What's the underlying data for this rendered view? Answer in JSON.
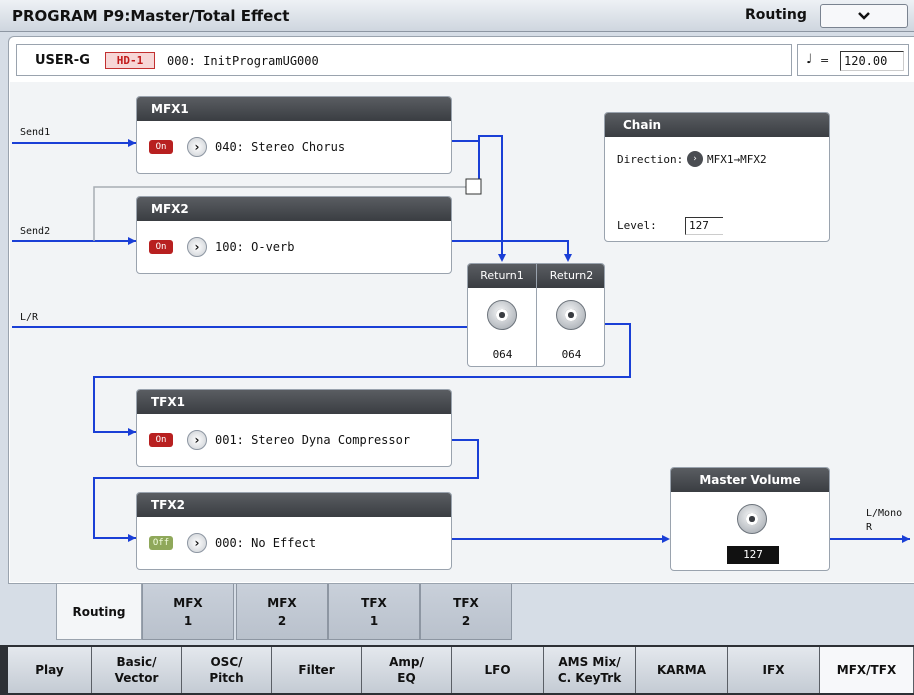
{
  "header": {
    "title": "PROGRAM P9:Master/Total Effect",
    "page_tag": "Routing"
  },
  "program": {
    "bank": "USER-G",
    "hd_badge": "HD-1",
    "name": "000: InitProgramUG000"
  },
  "tempo": {
    "note_symbol": "♩",
    "equals": "=",
    "value": "120.00"
  },
  "routes": {
    "send1": "Send1",
    "send2": "Send2",
    "lr": "L/R",
    "out_left": "L/Mono",
    "out_right": "R"
  },
  "mfx1": {
    "title": "MFX1",
    "state": "On",
    "effect": "040: Stereo Chorus"
  },
  "mfx2": {
    "title": "MFX2",
    "state": "On",
    "effect": "100: O-verb"
  },
  "tfx1": {
    "title": "TFX1",
    "state": "On",
    "effect": "001: Stereo Dyna Compressor"
  },
  "tfx2": {
    "title": "TFX2",
    "state": "Off",
    "effect": "000: No Effect"
  },
  "chain": {
    "title": "Chain",
    "direction_label": "Direction:",
    "direction_value": "MFX1→MFX2",
    "level_label": "Level:",
    "level_value": "127"
  },
  "returns": {
    "return1_label": "Return1",
    "return1_value": "064",
    "return2_label": "Return2",
    "return2_value": "064"
  },
  "master": {
    "title": "Master Volume",
    "value": "127"
  },
  "subtabs": [
    {
      "label": "Routing"
    },
    {
      "label": "MFX\n1"
    },
    {
      "label": "MFX\n2"
    },
    {
      "label": "TFX\n1"
    },
    {
      "label": "TFX\n2"
    }
  ],
  "bottom_tabs": [
    {
      "label": "Play"
    },
    {
      "label": "Basic/\nVector"
    },
    {
      "label": "OSC/\nPitch"
    },
    {
      "label": "Filter"
    },
    {
      "label": "Amp/\nEQ"
    },
    {
      "label": "LFO"
    },
    {
      "label": "AMS Mix/\nC. KeyTrk"
    },
    {
      "label": "KARMA"
    },
    {
      "label": "IFX"
    },
    {
      "label": "MFX/TFX"
    }
  ],
  "colors": {
    "route_blue": "#1a3fd6",
    "on_red": "#b82020",
    "off_green": "#8fa85a"
  },
  "icons": {
    "menu": "chevron-down-icon",
    "selector": "chevron-right-icon",
    "knob": "knob-icon"
  }
}
